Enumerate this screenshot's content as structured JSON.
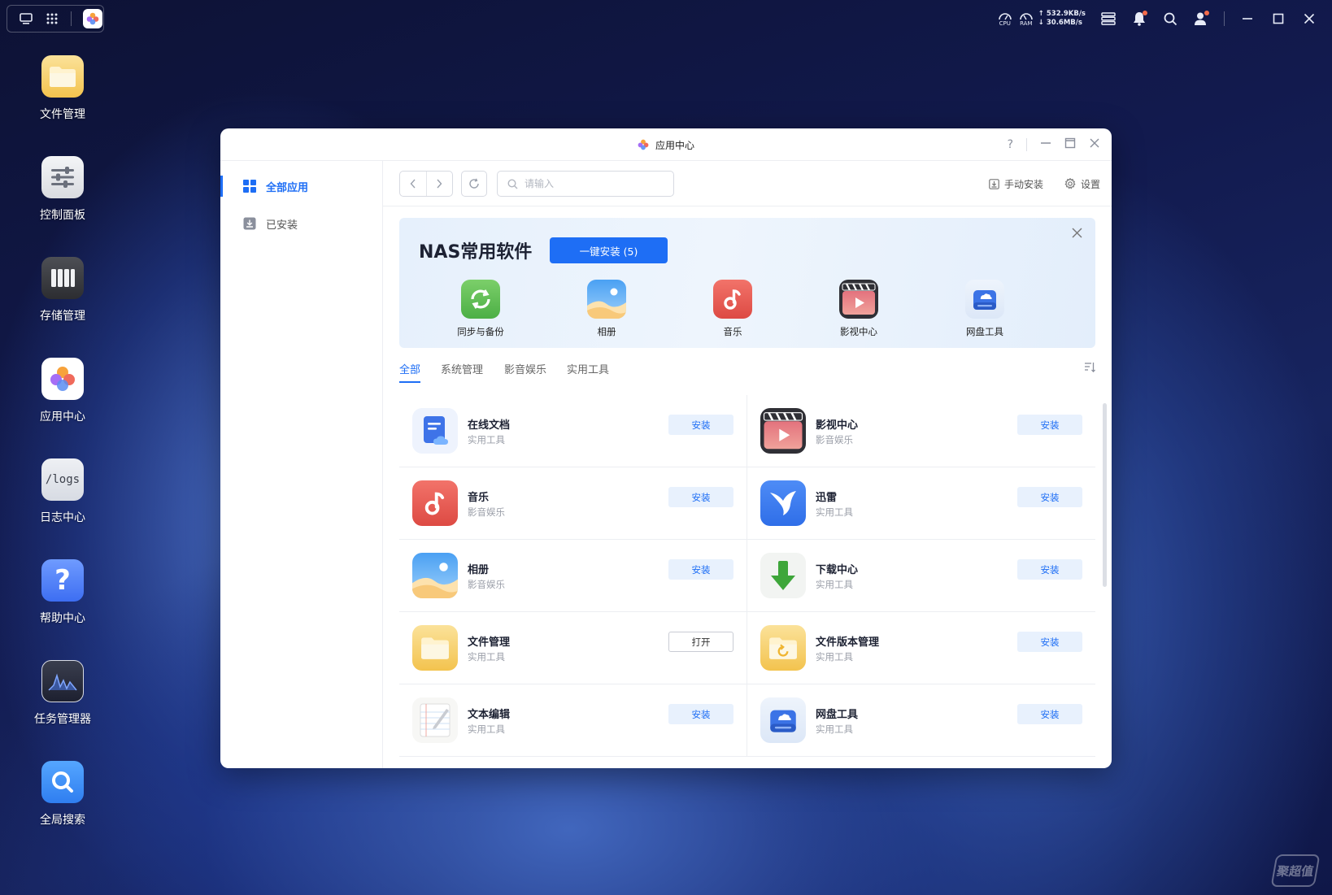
{
  "topbar": {
    "cpu_label": "CPU",
    "ram_label": "RAM",
    "upload": "↑ 532.9KB/s",
    "download": "↓ 30.6MB/s"
  },
  "desktop": [
    {
      "label": "文件管理",
      "icon": "folder-icon"
    },
    {
      "label": "控制面板",
      "icon": "control-panel-icon"
    },
    {
      "label": "存储管理",
      "icon": "storage-icon"
    },
    {
      "label": "应用中心",
      "icon": "app-center-icon"
    },
    {
      "label": "日志中心",
      "icon": "logs-icon",
      "icon_text": "/logs"
    },
    {
      "label": "帮助中心",
      "icon": "help-icon",
      "icon_text": "?"
    },
    {
      "label": "任务管理器",
      "icon": "task-manager-icon"
    },
    {
      "label": "全局搜索",
      "icon": "global-search-icon"
    }
  ],
  "window": {
    "title": "应用中心",
    "help": "?"
  },
  "sidebar": {
    "items": [
      {
        "label": "全部应用",
        "active": true
      },
      {
        "label": "已安装",
        "active": false
      }
    ]
  },
  "toolbar": {
    "search_placeholder": "请输入",
    "manual_install": "手动安装",
    "settings": "设置"
  },
  "banner": {
    "title": "NAS常用软件",
    "button": "一键安装 (5)",
    "apps": [
      {
        "label": "同步与备份"
      },
      {
        "label": "相册"
      },
      {
        "label": "音乐"
      },
      {
        "label": "影视中心"
      },
      {
        "label": "网盘工具"
      }
    ]
  },
  "tabs": [
    {
      "label": "全部",
      "active": true
    },
    {
      "label": "系统管理",
      "active": false
    },
    {
      "label": "影音娱乐",
      "active": false
    },
    {
      "label": "实用工具",
      "active": false
    }
  ],
  "apps": [
    {
      "name": "在线文档",
      "category": "实用工具",
      "action": "安装"
    },
    {
      "name": "影视中心",
      "category": "影音娱乐",
      "action": "安装"
    },
    {
      "name": "音乐",
      "category": "影音娱乐",
      "action": "安装"
    },
    {
      "name": "迅雷",
      "category": "实用工具",
      "action": "安装"
    },
    {
      "name": "相册",
      "category": "影音娱乐",
      "action": "安装"
    },
    {
      "name": "下载中心",
      "category": "实用工具",
      "action": "安装"
    },
    {
      "name": "文件管理",
      "category": "实用工具",
      "action": "打开"
    },
    {
      "name": "文件版本管理",
      "category": "实用工具",
      "action": "安装"
    },
    {
      "name": "文本编辑",
      "category": "实用工具",
      "action": "安装"
    },
    {
      "name": "网盘工具",
      "category": "实用工具",
      "action": "安装"
    }
  ],
  "watermark": "聚超值",
  "colors": {
    "accent": "#1e6ef5",
    "install_bg": "#e8f1fd"
  }
}
